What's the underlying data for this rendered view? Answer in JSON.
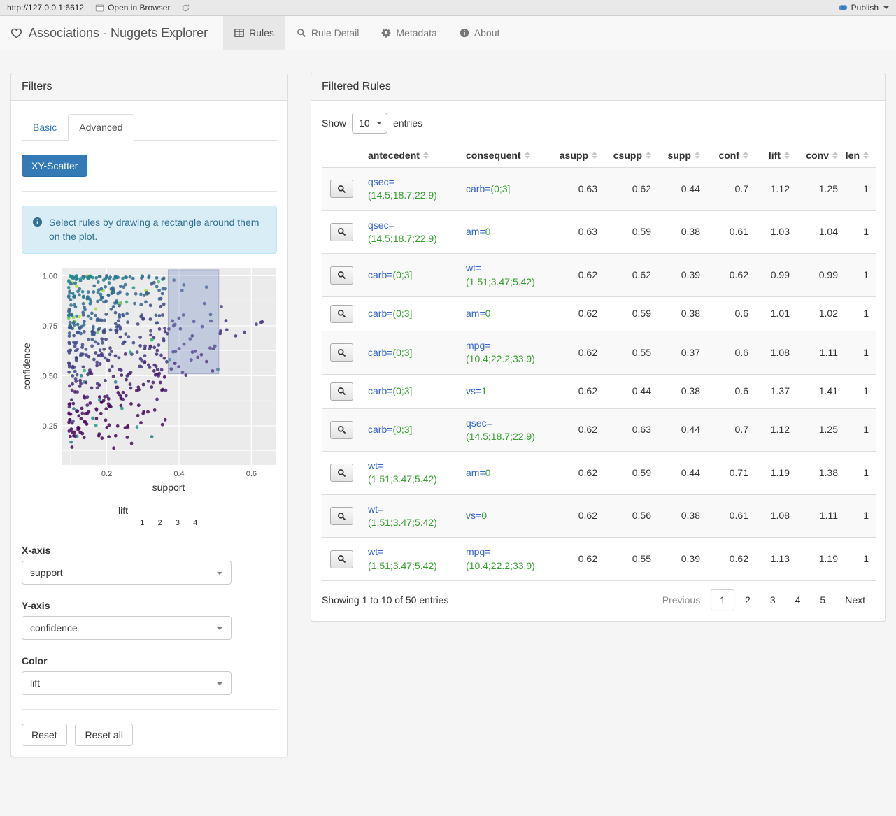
{
  "colors": {
    "accent": "#337ab7",
    "item_attribute": "#3366cc",
    "item_value": "#33a02c"
  },
  "browser_bar": {
    "url": "http://127.0.0.1:6612",
    "open_in_browser_label": "Open in Browser",
    "publish_label": "Publish"
  },
  "navbar": {
    "title": "Associations - Nuggets Explorer",
    "tabs": [
      {
        "label": "Rules",
        "active": true
      },
      {
        "label": "Rule Detail",
        "active": false
      },
      {
        "label": "Metadata",
        "active": false
      },
      {
        "label": "About",
        "active": false
      }
    ]
  },
  "filters": {
    "title": "Filters",
    "tabs": [
      {
        "label": "Basic",
        "active": false
      },
      {
        "label": "Advanced",
        "active": true
      }
    ],
    "scatter_button_label": "XY-Scatter",
    "info_text": "Select rules by drawing a rectangle around them on the plot.",
    "x_axis": {
      "label": "X-axis",
      "value": "support"
    },
    "y_axis": {
      "label": "Y-axis",
      "value": "confidence"
    },
    "color": {
      "label": "Color",
      "value": "lift"
    },
    "reset_label": "Reset",
    "reset_all_label": "Reset all"
  },
  "chart_data": {
    "type": "scatter",
    "xlabel": "support",
    "ylabel": "confidence",
    "xlim": [
      0.077,
      0.667
    ],
    "ylim": [
      0.054,
      1.04
    ],
    "x_ticks": [
      "0.2",
      "0.4",
      "0.6"
    ],
    "y_ticks": [
      "1.00",
      "0.75",
      "0.50",
      "0.25"
    ],
    "grid": true,
    "color_legend": {
      "title": "lift",
      "ticks": [
        "1",
        "2",
        "3",
        "4"
      ],
      "palette": "viridis"
    },
    "selection_rect": {
      "x0": 0.37,
      "x1": 0.51,
      "y0": 0.51,
      "y1": 1.03
    },
    "point_count": 560,
    "seed": 42
  },
  "table_panel": {
    "title": "Filtered Rules",
    "show_label": "Show",
    "entries_label": "entries",
    "page_length": "10",
    "columns": [
      "antecedent",
      "consequent",
      "asupp",
      "csupp",
      "supp",
      "conf",
      "lift",
      "conv",
      "len"
    ],
    "rows": [
      {
        "antecedent": {
          "name": "qsec=",
          "value": "(14.5;18.7;22.9)"
        },
        "consequent": {
          "name": "carb=",
          "value": "(0;3]"
        },
        "asupp": "0.63",
        "csupp": "0.62",
        "supp": "0.44",
        "conf": "0.7",
        "lift": "1.12",
        "conv": "1.25",
        "len": "1"
      },
      {
        "antecedent": {
          "name": "qsec=",
          "value": "(14.5;18.7;22.9)"
        },
        "consequent": {
          "name": "am=",
          "value": "0"
        },
        "asupp": "0.63",
        "csupp": "0.59",
        "supp": "0.38",
        "conf": "0.61",
        "lift": "1.03",
        "conv": "1.04",
        "len": "1"
      },
      {
        "antecedent": {
          "name": "carb=",
          "value": "(0;3]"
        },
        "consequent": {
          "name": "wt=",
          "value": "(1.51;3.47;5.42)"
        },
        "asupp": "0.62",
        "csupp": "0.62",
        "supp": "0.39",
        "conf": "0.62",
        "lift": "0.99",
        "conv": "0.99",
        "len": "1"
      },
      {
        "antecedent": {
          "name": "carb=",
          "value": "(0;3]"
        },
        "consequent": {
          "name": "am=",
          "value": "0"
        },
        "asupp": "0.62",
        "csupp": "0.59",
        "supp": "0.38",
        "conf": "0.6",
        "lift": "1.01",
        "conv": "1.02",
        "len": "1"
      },
      {
        "antecedent": {
          "name": "carb=",
          "value": "(0;3]"
        },
        "consequent": {
          "name": "mpg=",
          "value": "(10.4;22.2;33.9)"
        },
        "asupp": "0.62",
        "csupp": "0.55",
        "supp": "0.37",
        "conf": "0.6",
        "lift": "1.08",
        "conv": "1.11",
        "len": "1"
      },
      {
        "antecedent": {
          "name": "carb=",
          "value": "(0;3]"
        },
        "consequent": {
          "name": "vs=",
          "value": "1"
        },
        "asupp": "0.62",
        "csupp": "0.44",
        "supp": "0.38",
        "conf": "0.6",
        "lift": "1.37",
        "conv": "1.41",
        "len": "1"
      },
      {
        "antecedent": {
          "name": "carb=",
          "value": "(0;3]"
        },
        "consequent": {
          "name": "qsec=",
          "value": "(14.5;18.7;22.9)"
        },
        "asupp": "0.62",
        "csupp": "0.63",
        "supp": "0.44",
        "conf": "0.7",
        "lift": "1.12",
        "conv": "1.25",
        "len": "1"
      },
      {
        "antecedent": {
          "name": "wt=",
          "value": "(1.51;3.47;5.42)"
        },
        "consequent": {
          "name": "am=",
          "value": "0"
        },
        "asupp": "0.62",
        "csupp": "0.59",
        "supp": "0.44",
        "conf": "0.71",
        "lift": "1.19",
        "conv": "1.38",
        "len": "1"
      },
      {
        "antecedent": {
          "name": "wt=",
          "value": "(1.51;3.47;5.42)"
        },
        "consequent": {
          "name": "vs=",
          "value": "0"
        },
        "asupp": "0.62",
        "csupp": "0.56",
        "supp": "0.38",
        "conf": "0.61",
        "lift": "1.08",
        "conv": "1.11",
        "len": "1"
      },
      {
        "antecedent": {
          "name": "wt=",
          "value": "(1.51;3.47;5.42)"
        },
        "consequent": {
          "name": "mpg=",
          "value": "(10.4;22.2;33.9)"
        },
        "asupp": "0.62",
        "csupp": "0.55",
        "supp": "0.39",
        "conf": "0.62",
        "lift": "1.13",
        "conv": "1.19",
        "len": "1"
      }
    ],
    "footer_info": "Showing 1 to 10 of 50 entries",
    "pagination": {
      "previous": "Previous",
      "pages": [
        "1",
        "2",
        "3",
        "4",
        "5"
      ],
      "active_page": "1",
      "next": "Next"
    }
  }
}
